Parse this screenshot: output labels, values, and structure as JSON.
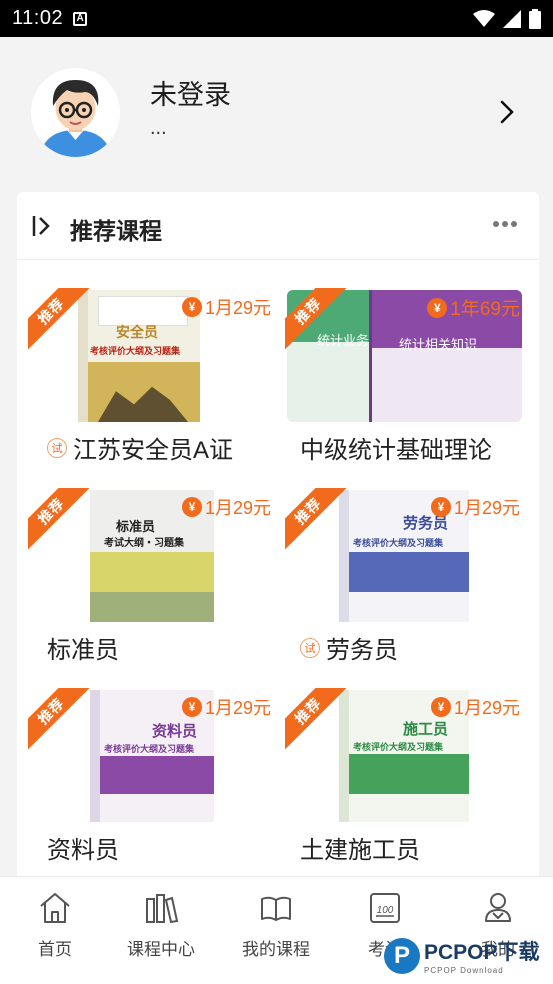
{
  "status": {
    "time": "11:02",
    "notif_icon": "a-notification-icon"
  },
  "profile": {
    "name": "未登录",
    "subtitle": "..."
  },
  "section": {
    "title": "推荐课程"
  },
  "courses": [
    {
      "title": "江苏安全员A证",
      "price": "1月29元",
      "badge": "推荐",
      "trial": "试",
      "book_title": "安全员",
      "book_subtitle": "考核评价大纲及习题集"
    },
    {
      "title": "中级统计基础理论",
      "price": "1年69元",
      "badge": "推荐",
      "book_title": "统计业务知识",
      "book_title2": "统计相关知识"
    },
    {
      "title": "标准员",
      "price": "1月29元",
      "badge": "推荐",
      "book_title": "标准员",
      "book_subtitle": "考试大纲・习题集"
    },
    {
      "title": "劳务员",
      "price": "1月29元",
      "badge": "推荐",
      "trial": "试",
      "book_title": "劳务员",
      "book_subtitle": "考核评价大纲及习题集"
    },
    {
      "title": "资料员",
      "price": "1月29元",
      "badge": "推荐",
      "book_title": "资料员",
      "book_subtitle": "考核评价大纲及习题集"
    },
    {
      "title": "土建施工员",
      "price": "1月29元",
      "badge": "推荐",
      "book_title": "施工员",
      "book_subtitle": "考核评价大纲及习题集"
    }
  ],
  "nav": [
    {
      "label": "首页",
      "icon": "home-icon"
    },
    {
      "label": "课程中心",
      "icon": "books-icon"
    },
    {
      "label": "我的课程",
      "icon": "open-book-icon"
    },
    {
      "label": "考试",
      "icon": "exam-100-icon"
    },
    {
      "label": "我的",
      "icon": "user-icon"
    }
  ],
  "watermark": {
    "logo": "P",
    "text": "PCPOP下载",
    "sub": "PCPOP Download"
  },
  "colors": {
    "accent": "#f26a1b",
    "background": "#f3f3f3"
  }
}
